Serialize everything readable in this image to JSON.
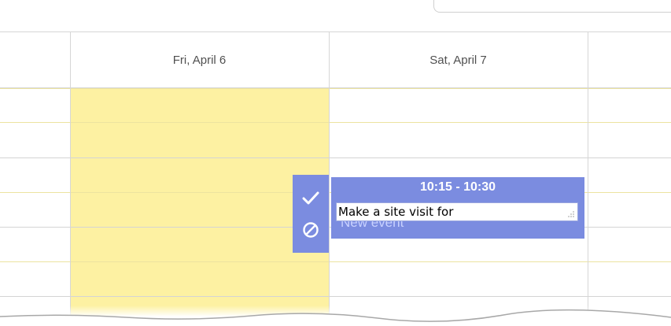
{
  "header": {
    "columns": [
      {
        "label": ""
      },
      {
        "label": "Fri, April 6"
      },
      {
        "label": "Sat, April 7"
      },
      {
        "label": ""
      }
    ]
  },
  "event": {
    "time_range": "10:15 - 10:30",
    "title_input_value": "Make a site visit for",
    "ghost_text": "New event",
    "color": "#7b8ce0"
  },
  "actions": {
    "confirm_icon": "checkmark-icon",
    "cancel_icon": "cancel-icon"
  },
  "colors": {
    "today_column": "#fdf1a2",
    "grid_line": "#e4e4e4"
  }
}
